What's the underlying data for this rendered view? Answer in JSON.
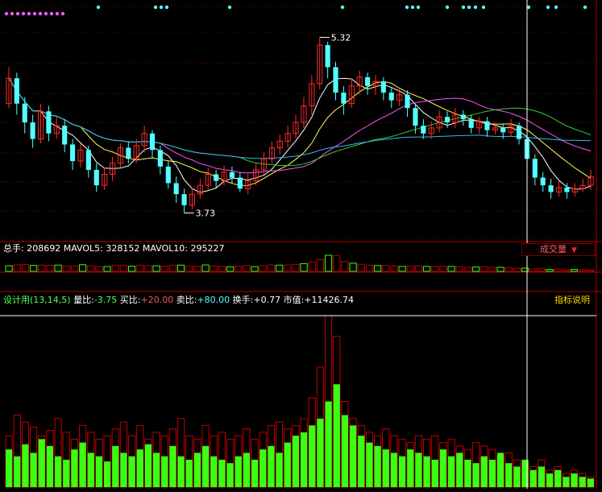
{
  "colors": {
    "background": "#000000",
    "up": "#ff2a2a",
    "down": "#54ffff",
    "grid": "#8b0000",
    "ma_white": "#ffffff",
    "ma_yellow": "#ffff55",
    "ma_magenta": "#ff55ff",
    "ma_green": "#33cc33",
    "ma_cyan": "#33bbee",
    "volume_green": "#39ff14",
    "volume_red": "#c00000"
  },
  "price_panel": {
    "high_label": "5.32",
    "low_label": "3.73"
  },
  "volume_panel": {
    "total_label": "总手:",
    "total_value": "208692",
    "mavol5_label": "MAVOL5:",
    "mavol5_value": "328152",
    "mavol10_label": "MAVOL10:",
    "mavol10_value": "295227",
    "button_label": "成交量"
  },
  "indicator_panel": {
    "name": "设计用(13,14,5)",
    "ratio_label": "量比:",
    "ratio_value": "-3.75",
    "buy_label": "买比:",
    "buy_value": "+20.00",
    "sell_label": "卖比:",
    "sell_value": "+80.00",
    "turnover_label": "换手:",
    "turnover_value": "+0.77",
    "market_label": "市值:",
    "market_value": "+11426.74",
    "button_label": "指标说明"
  },
  "chart_data": [
    {
      "type": "candlestick",
      "title": "",
      "ylim": [
        3.5,
        5.6
      ],
      "high": 5.32,
      "low": 3.73,
      "candles": [
        {
          "o": 4.72,
          "c": 4.95,
          "h": 5.05,
          "l": 4.68
        },
        {
          "o": 4.95,
          "c": 4.72,
          "h": 5.0,
          "l": 4.62
        },
        {
          "o": 4.72,
          "c": 4.55,
          "h": 4.78,
          "l": 4.45
        },
        {
          "o": 4.55,
          "c": 4.4,
          "h": 4.62,
          "l": 4.32
        },
        {
          "o": 4.4,
          "c": 4.65,
          "h": 4.72,
          "l": 4.36
        },
        {
          "o": 4.65,
          "c": 4.45,
          "h": 4.7,
          "l": 4.38
        },
        {
          "o": 4.45,
          "c": 4.52,
          "h": 4.6,
          "l": 4.4
        },
        {
          "o": 4.52,
          "c": 4.35,
          "h": 4.58,
          "l": 4.28
        },
        {
          "o": 4.35,
          "c": 4.2,
          "h": 4.4,
          "l": 4.12
        },
        {
          "o": 4.2,
          "c": 4.3,
          "h": 4.36,
          "l": 4.14
        },
        {
          "o": 4.3,
          "c": 4.12,
          "h": 4.34,
          "l": 4.05
        },
        {
          "o": 4.12,
          "c": 3.98,
          "h": 4.18,
          "l": 3.92
        },
        {
          "o": 3.98,
          "c": 4.08,
          "h": 4.14,
          "l": 3.94
        },
        {
          "o": 4.08,
          "c": 4.18,
          "h": 4.24,
          "l": 4.02
        },
        {
          "o": 4.18,
          "c": 4.32,
          "h": 4.36,
          "l": 4.14
        },
        {
          "o": 4.32,
          "c": 4.22,
          "h": 4.38,
          "l": 4.18
        },
        {
          "o": 4.22,
          "c": 4.34,
          "h": 4.4,
          "l": 4.18
        },
        {
          "o": 4.34,
          "c": 4.45,
          "h": 4.52,
          "l": 4.28
        },
        {
          "o": 4.45,
          "c": 4.3,
          "h": 4.48,
          "l": 4.22
        },
        {
          "o": 4.3,
          "c": 4.15,
          "h": 4.34,
          "l": 4.08
        },
        {
          "o": 4.15,
          "c": 4.0,
          "h": 4.2,
          "l": 3.95
        },
        {
          "o": 4.0,
          "c": 3.9,
          "h": 4.06,
          "l": 3.82
        },
        {
          "o": 3.9,
          "c": 3.8,
          "h": 3.95,
          "l": 3.73
        },
        {
          "o": 3.8,
          "c": 3.9,
          "h": 3.96,
          "l": 3.76
        },
        {
          "o": 3.9,
          "c": 3.98,
          "h": 4.04,
          "l": 3.86
        },
        {
          "o": 3.98,
          "c": 4.08,
          "h": 4.14,
          "l": 3.94
        },
        {
          "o": 4.08,
          "c": 4.02,
          "h": 4.12,
          "l": 3.96
        },
        {
          "o": 4.02,
          "c": 4.1,
          "h": 4.16,
          "l": 3.98
        },
        {
          "o": 4.1,
          "c": 4.05,
          "h": 4.15,
          "l": 4.0
        },
        {
          "o": 4.05,
          "c": 3.95,
          "h": 4.1,
          "l": 3.92
        },
        {
          "o": 3.95,
          "c": 4.02,
          "h": 4.08,
          "l": 3.9
        },
        {
          "o": 4.02,
          "c": 4.12,
          "h": 4.18,
          "l": 3.98
        },
        {
          "o": 4.12,
          "c": 4.22,
          "h": 4.28,
          "l": 4.08
        },
        {
          "o": 4.22,
          "c": 4.32,
          "h": 4.38,
          "l": 4.18
        },
        {
          "o": 4.32,
          "c": 4.38,
          "h": 4.44,
          "l": 4.26
        },
        {
          "o": 4.38,
          "c": 4.45,
          "h": 4.52,
          "l": 4.32
        },
        {
          "o": 4.45,
          "c": 4.55,
          "h": 4.62,
          "l": 4.4
        },
        {
          "o": 4.55,
          "c": 4.7,
          "h": 4.78,
          "l": 4.5
        },
        {
          "o": 4.7,
          "c": 4.9,
          "h": 4.98,
          "l": 4.62
        },
        {
          "o": 4.9,
          "c": 5.25,
          "h": 5.32,
          "l": 4.85
        },
        {
          "o": 5.25,
          "c": 5.05,
          "h": 5.28,
          "l": 4.95
        },
        {
          "o": 5.05,
          "c": 4.82,
          "h": 5.1,
          "l": 4.75
        },
        {
          "o": 4.82,
          "c": 4.72,
          "h": 4.88,
          "l": 4.62
        },
        {
          "o": 4.72,
          "c": 4.88,
          "h": 4.95,
          "l": 4.68
        },
        {
          "o": 4.88,
          "c": 4.96,
          "h": 5.02,
          "l": 4.8
        },
        {
          "o": 4.96,
          "c": 4.88,
          "h": 5.0,
          "l": 4.8
        },
        {
          "o": 4.88,
          "c": 4.92,
          "h": 4.98,
          "l": 4.8
        },
        {
          "o": 4.92,
          "c": 4.82,
          "h": 4.96,
          "l": 4.75
        },
        {
          "o": 4.82,
          "c": 4.75,
          "h": 4.86,
          "l": 4.68
        },
        {
          "o": 4.75,
          "c": 4.8,
          "h": 4.86,
          "l": 4.7
        },
        {
          "o": 4.8,
          "c": 4.68,
          "h": 4.84,
          "l": 4.6
        },
        {
          "o": 4.68,
          "c": 4.52,
          "h": 4.72,
          "l": 4.45
        },
        {
          "o": 4.52,
          "c": 4.45,
          "h": 4.58,
          "l": 4.4
        },
        {
          "o": 4.45,
          "c": 4.5,
          "h": 4.56,
          "l": 4.4
        },
        {
          "o": 4.5,
          "c": 4.6,
          "h": 4.66,
          "l": 4.46
        },
        {
          "o": 4.6,
          "c": 4.55,
          "h": 4.65,
          "l": 4.5
        },
        {
          "o": 4.55,
          "c": 4.62,
          "h": 4.68,
          "l": 4.5
        },
        {
          "o": 4.62,
          "c": 4.58,
          "h": 4.66,
          "l": 4.52
        },
        {
          "o": 4.58,
          "c": 4.5,
          "h": 4.62,
          "l": 4.45
        },
        {
          "o": 4.5,
          "c": 4.56,
          "h": 4.6,
          "l": 4.45
        },
        {
          "o": 4.56,
          "c": 4.48,
          "h": 4.6,
          "l": 4.42
        },
        {
          "o": 4.48,
          "c": 4.5,
          "h": 4.55,
          "l": 4.44
        },
        {
          "o": 4.5,
          "c": 4.46,
          "h": 4.54,
          "l": 4.4
        },
        {
          "o": 4.46,
          "c": 4.52,
          "h": 4.58,
          "l": 4.42
        },
        {
          "o": 4.52,
          "c": 4.4,
          "h": 4.55,
          "l": 4.35
        },
        {
          "o": 4.4,
          "c": 4.22,
          "h": 4.44,
          "l": 4.15
        },
        {
          "o": 4.22,
          "c": 4.05,
          "h": 4.26,
          "l": 3.98
        },
        {
          "o": 4.05,
          "c": 3.98,
          "h": 4.1,
          "l": 3.92
        },
        {
          "o": 3.98,
          "c": 3.92,
          "h": 4.04,
          "l": 3.86
        },
        {
          "o": 3.92,
          "c": 3.96,
          "h": 4.02,
          "l": 3.88
        },
        {
          "o": 3.96,
          "c": 3.92,
          "h": 4.0,
          "l": 3.86
        },
        {
          "o": 3.92,
          "c": 3.95,
          "h": 4.0,
          "l": 3.88
        },
        {
          "o": 3.95,
          "c": 3.98,
          "h": 4.04,
          "l": 3.92
        },
        {
          "o": 3.98,
          "c": 4.06,
          "h": 4.12,
          "l": 3.94
        }
      ]
    },
    {
      "type": "bar",
      "title": "",
      "series": [
        {
          "name": "买比",
          "values": [
            22,
            18,
            25,
            20,
            28,
            24,
            18,
            16,
            22,
            26,
            20,
            18,
            15,
            24,
            20,
            18,
            22,
            25,
            20,
            18,
            24,
            18,
            16,
            20,
            24,
            18,
            16,
            14,
            18,
            20,
            16,
            22,
            24,
            20,
            26,
            30,
            32,
            36,
            40,
            50,
            60,
            42,
            36,
            30,
            26,
            24,
            22,
            20,
            18,
            22,
            20,
            18,
            16,
            22,
            18,
            20,
            16,
            14,
            18,
            16,
            20,
            14,
            12,
            16,
            10,
            12,
            8,
            10,
            6,
            8,
            6,
            5
          ]
        },
        {
          "name": "卖比",
          "values": [
            30,
            42,
            38,
            35,
            30,
            33,
            40,
            32,
            28,
            36,
            32,
            28,
            30,
            34,
            38,
            30,
            36,
            28,
            32,
            30,
            34,
            40,
            30,
            28,
            36,
            30,
            32,
            28,
            30,
            34,
            28,
            32,
            36,
            38,
            34,
            36,
            40,
            52,
            70,
            100,
            88,
            50,
            40,
            36,
            32,
            30,
            34,
            30,
            28,
            26,
            30,
            28,
            30,
            26,
            28,
            24,
            22,
            26,
            24,
            22,
            18,
            20,
            16,
            14,
            12,
            16,
            10,
            12,
            8,
            10,
            8,
            6
          ]
        }
      ]
    }
  ]
}
